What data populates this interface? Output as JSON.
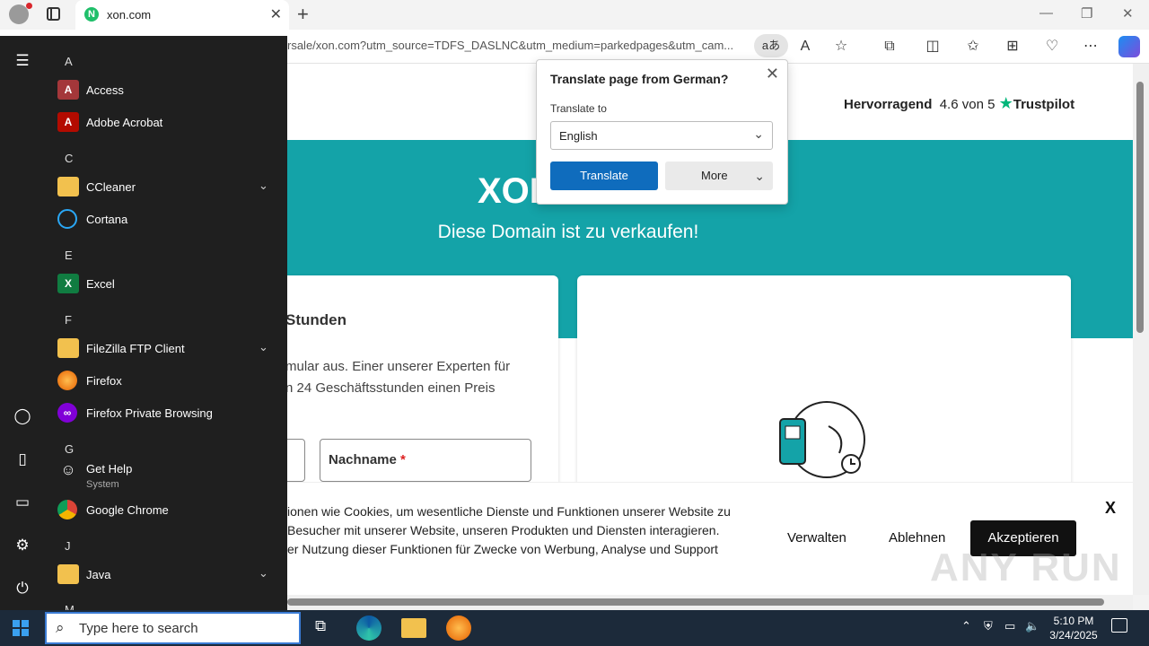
{
  "browser": {
    "tab_title": "xon.com",
    "url": "rsale/xon.com?utm_source=TDFS_DASLNC&utm_medium=parkedpages&utm_cam...",
    "translate_pill": "aあ"
  },
  "page": {
    "trust_label": "Hervorragend",
    "trust_score": "4.6 von 5",
    "trust_brand": "Trustpilot",
    "logo_text": "XON",
    "tagline": "Diese Domain ist zu verkaufen!",
    "card_heading": "Stunden",
    "card_text_1": "mular aus. Einer unserer Experten für",
    "card_text_2": "n 24 Geschäftsstunden einen Preis",
    "field_lastname": "Nachname",
    "required_mark": "*"
  },
  "cookie": {
    "line1": "ionen wie Cookies, um wesentliche Dienste und Funktionen unserer Website zu",
    "line2": "Besucher mit unserer Website, unseren Produkten und Diensten interagieren.",
    "line3": "er Nutzung dieser Funktionen für Zwecke von Werbung, Analyse und Support",
    "manage": "Verwalten",
    "decline": "Ablehnen",
    "accept": "Akzeptieren",
    "close": "X"
  },
  "translate_popup": {
    "title": "Translate page from German?",
    "label": "Translate to",
    "language": "English",
    "translate_btn": "Translate",
    "more_btn": "More"
  },
  "start_menu": {
    "letters": [
      "A",
      "C",
      "E",
      "F",
      "G",
      "J",
      "M"
    ],
    "apps": [
      {
        "name": "Access",
        "icon": "access-icon",
        "color": "#a4373a",
        "glyph": "A"
      },
      {
        "name": "Adobe Acrobat",
        "icon": "acrobat-icon",
        "color": "#b30b00",
        "glyph": "A"
      },
      {
        "name": "CCleaner",
        "icon": "folder-icon",
        "expand": "⌄"
      },
      {
        "name": "Cortana",
        "icon": "cortana-icon"
      },
      {
        "name": "Excel",
        "icon": "excel-icon",
        "color": "#107c41",
        "glyph": "X"
      },
      {
        "name": "FileZilla FTP Client",
        "icon": "folder-icon",
        "expand": "⌄"
      },
      {
        "name": "Firefox",
        "icon": "firefox-icon"
      },
      {
        "name": "Firefox Private Browsing",
        "icon": "firefox-private-icon"
      },
      {
        "name": "Get Help",
        "sub": "System",
        "icon": "help-icon"
      },
      {
        "name": "Google Chrome",
        "icon": "chrome-icon"
      },
      {
        "name": "Java",
        "icon": "folder-icon",
        "expand": "⌄"
      }
    ]
  },
  "taskbar": {
    "search_placeholder": "Type here to search",
    "time": "5:10 PM",
    "date": "3/24/2025"
  },
  "watermark": "ANY RUN"
}
